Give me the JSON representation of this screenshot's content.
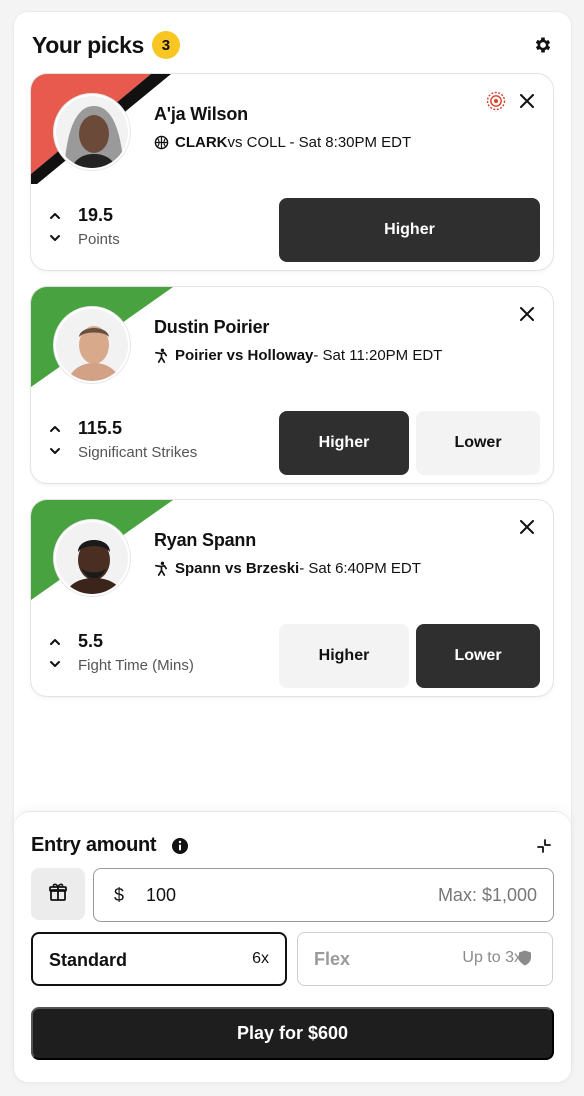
{
  "header": {
    "title": "Your picks",
    "count": "3"
  },
  "picks": [
    {
      "player": "A'ja Wilson",
      "team": "CLARK",
      "matchup_rest": " vs COLL - Sat 8:30PM EDT",
      "line": "19.5",
      "stat": "Points",
      "higher_label": "Higher",
      "stripe_colors": [
        "#e8594e",
        "#111111"
      ],
      "selected": "Higher"
    },
    {
      "player": "Dustin Poirier",
      "team": "Poirier vs Holloway",
      "matchup_rest": " - Sat 11:20PM EDT",
      "line": "115.5",
      "stat": "Significant Strikes",
      "higher_label": "Higher",
      "lower_label": "Lower",
      "stripe_colors": [
        "#47a23f"
      ],
      "selected": "Higher"
    },
    {
      "player": "Ryan Spann",
      "team": "Spann vs Brzeski",
      "matchup_rest": " - Sat 6:40PM EDT",
      "line": "5.5",
      "stat": "Fight Time (Mins)",
      "higher_label": "Higher",
      "lower_label": "Lower",
      "stripe_colors": [
        "#47a23f"
      ],
      "selected": "Lower"
    }
  ],
  "entry": {
    "title": "Entry amount",
    "currency": "$",
    "amount": "100",
    "max": "Max: $1,000",
    "standard_label": "Standard",
    "standard_mult": "6x",
    "flex_label": "Flex",
    "flex_mult": "Up to 3x",
    "play_label": "Play for $600"
  },
  "icons": {
    "gear": "gear-icon",
    "close": "close-icon",
    "target": "target-icon",
    "basketball": "basketball-icon",
    "mma": "fighter-icon",
    "gift": "gift-icon",
    "info": "info-icon",
    "collapse": "collapse-icon",
    "shield": "shield-icon"
  },
  "colors": {
    "badge": "#f7c623",
    "dark_button": "#2f2f2f",
    "play_button": "#1e1e1e"
  }
}
